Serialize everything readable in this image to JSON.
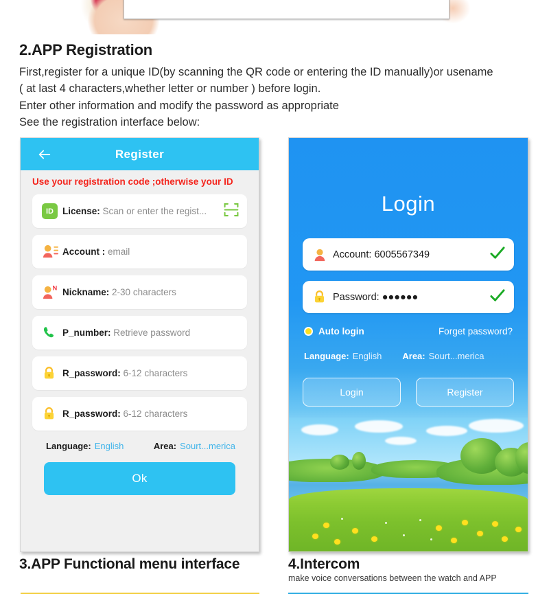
{
  "article": {
    "heading": "2.APP Registration",
    "lines": [
      "First,register for a unique ID(by scanning the QR code or entering the ID manually)or usename",
      "( at last 4 characters,whether letter or number ) before login.",
      "Enter other information and modify the password as appropriate",
      "See the registration interface below:"
    ]
  },
  "register_screen": {
    "back_icon": "back-arrow-icon",
    "title": "Register",
    "warning": "Use your registration code ;otherwise your ID",
    "fields": [
      {
        "icon": "id-badge-icon",
        "icon_text": "ID",
        "label": "License:",
        "value": "Scan or enter the regist...",
        "trailing_icon": "qr-scan-icon"
      },
      {
        "icon": "account-person-icon",
        "icon_text": "",
        "label": "Account :",
        "value": "email",
        "trailing_icon": ""
      },
      {
        "icon": "nickname-person-icon",
        "icon_text": "N",
        "label": "Nickname:",
        "value": "2-30 characters",
        "trailing_icon": ""
      },
      {
        "icon": "phone-icon",
        "icon_text": "",
        "label": "P_number:",
        "value": "Retrieve password",
        "trailing_icon": ""
      },
      {
        "icon": "lock-icon",
        "icon_text": "",
        "label": "R_password:",
        "value": "6-12 characters",
        "trailing_icon": ""
      },
      {
        "icon": "lock-icon",
        "icon_text": "",
        "label": "R_password:",
        "value": "6-12 characters",
        "trailing_icon": ""
      }
    ],
    "language_label": "Language:",
    "language_value": "English",
    "area_label": "Area:",
    "area_value": "Sourt...merica",
    "ok_label": "Ok",
    "colors": {
      "header": "#2ec2f2",
      "warning": "#f4251d",
      "link": "#3fb4ea",
      "button": "#2ec2f2"
    }
  },
  "login_screen": {
    "title": "Login",
    "fields": [
      {
        "icon": "account-person-icon",
        "label": "Account:",
        "value": "6005567349",
        "status_icon": "green-check-icon"
      },
      {
        "icon": "lock-icon",
        "label": "Password:",
        "value": "●●●●●●",
        "status_icon": "green-check-icon"
      }
    ],
    "auto_login_label": "Auto login",
    "auto_login_checked": true,
    "forget_password_label": "Forget password?",
    "language_label": "Language:",
    "language_value": "English",
    "area_label": "Area:",
    "area_value": "Sourt...merica",
    "login_label": "Login",
    "register_label": "Register",
    "colors": {
      "background": "#1f93f2",
      "radio": "#ffe01f",
      "check": "#1aaa24"
    }
  },
  "captions": {
    "section3_title": "3.APP Functional menu interface",
    "section3_bar_color": "#f2ce3e",
    "section4_title": "4.Intercom",
    "section4_subtitle": "make voice conversations between the watch and APP",
    "section4_bar_color": "#29abe2"
  }
}
